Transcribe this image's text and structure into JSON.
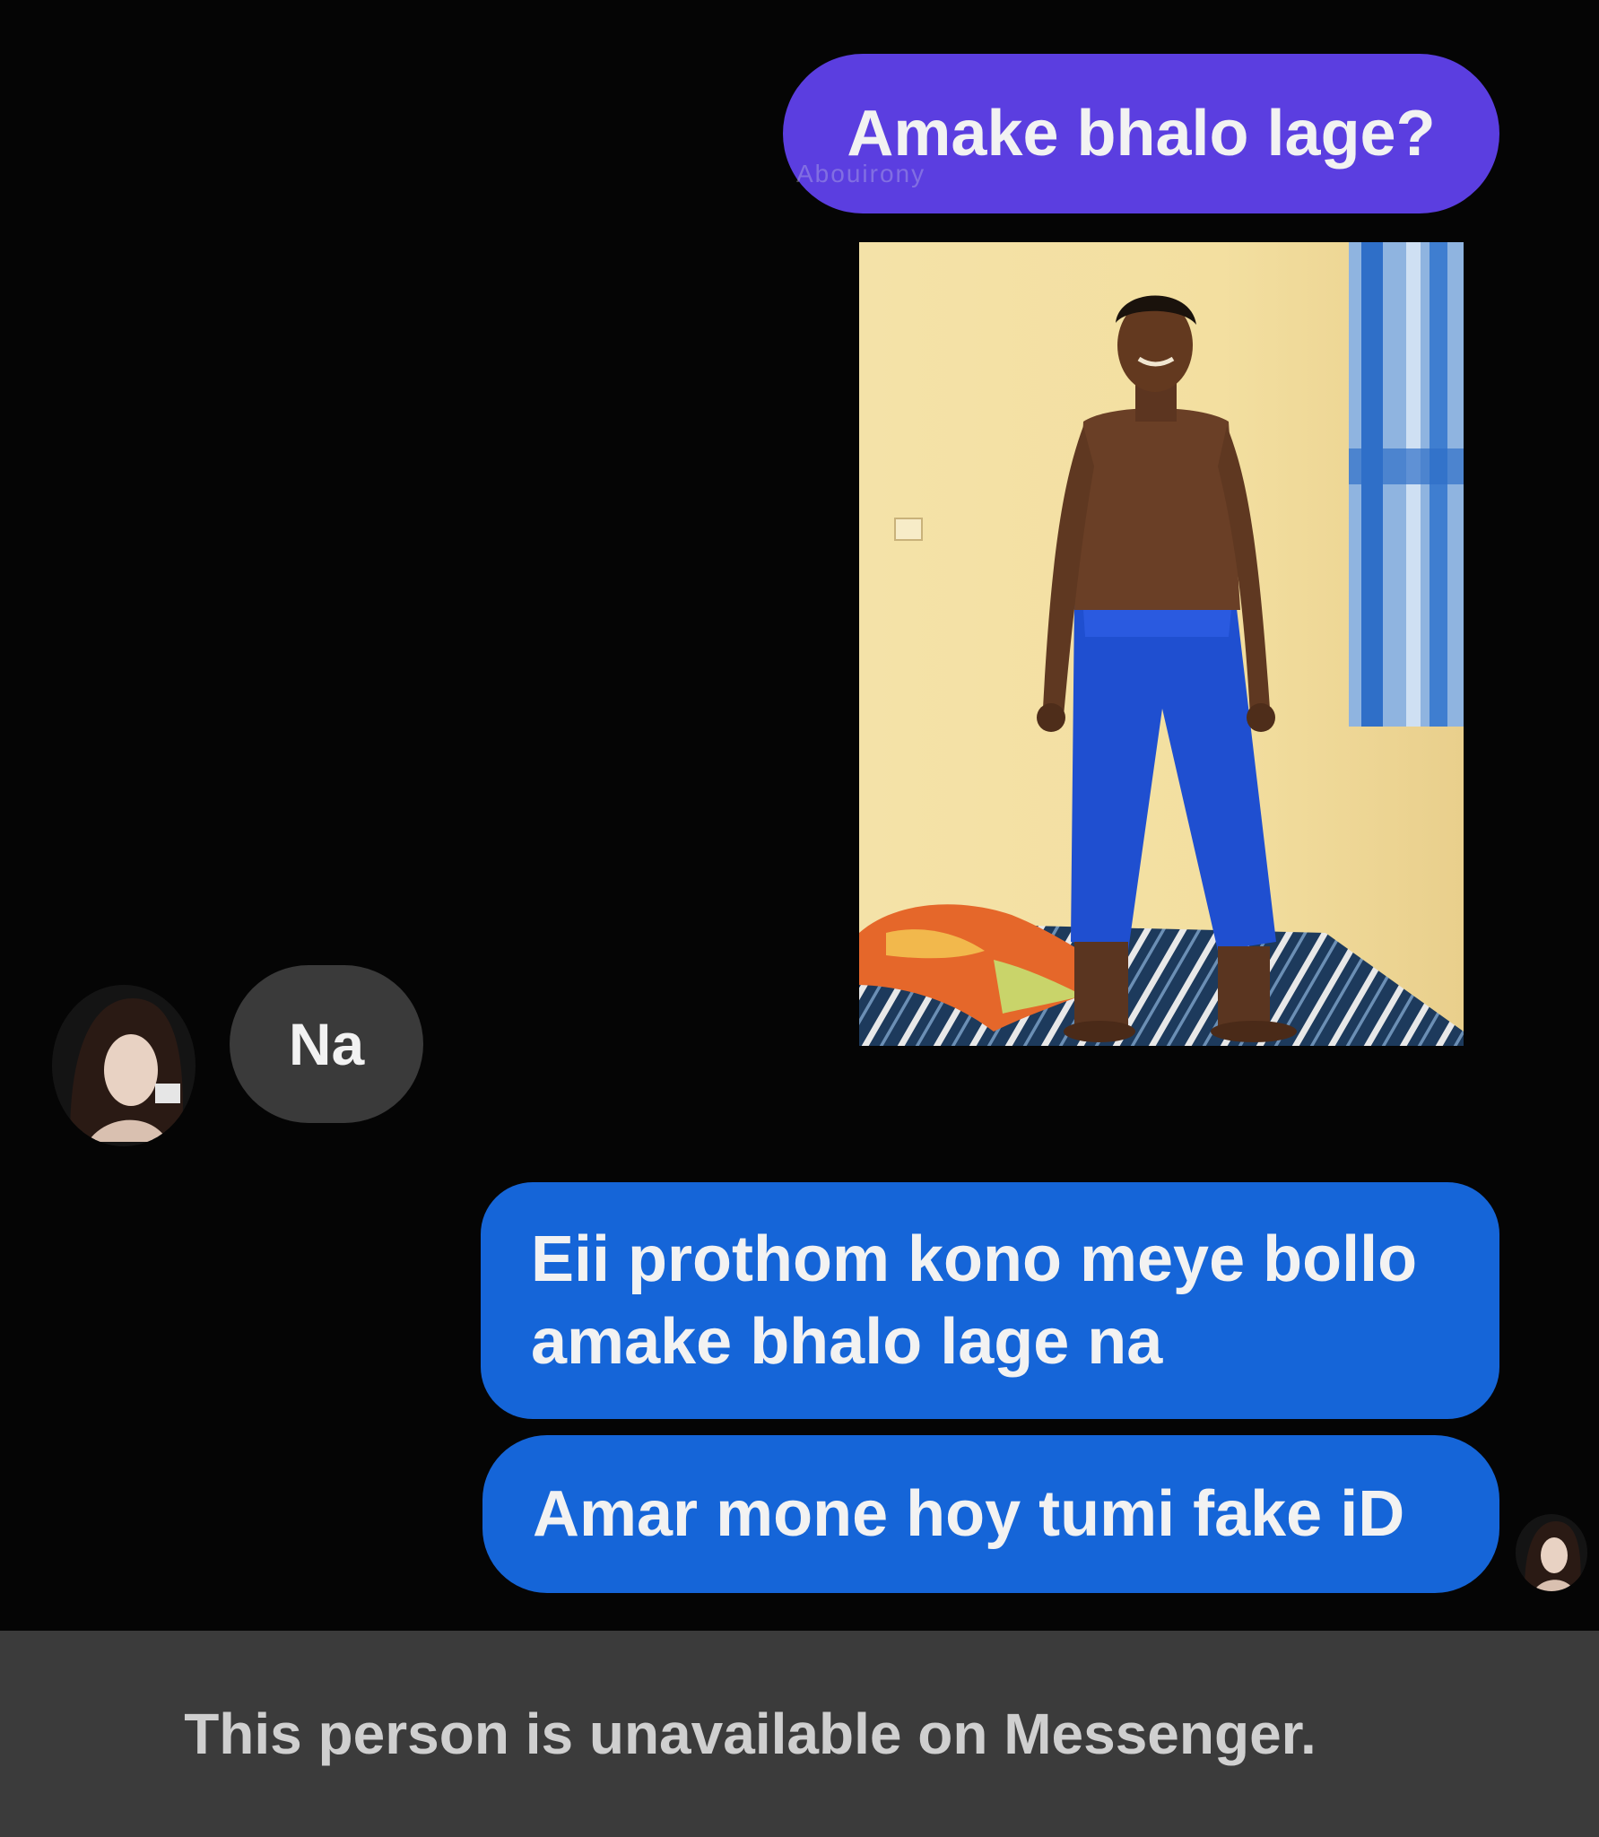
{
  "messages": {
    "sent_question": "Amake bhalo lage?",
    "reply_na": "Na",
    "sent_long_line1": "Eii prothom kono meye bollo",
    "sent_long_line2": "amake bhalo lage na",
    "sent_fake": "Amar mone hoy tumi fake iD"
  },
  "watermark": "Abouirony",
  "footer": {
    "status_text": "This person is unavailable on Messenger."
  },
  "colors": {
    "outgoing_purple": "#5b3ee0",
    "outgoing_blue": "#1565d8",
    "incoming_gray": "#3a3a3a",
    "background": "#050505",
    "footer_bg": "#3b3b3b"
  },
  "icons": {
    "left_avatar": "contact-avatar-icon",
    "right_avatar": "seen-avatar-icon"
  }
}
